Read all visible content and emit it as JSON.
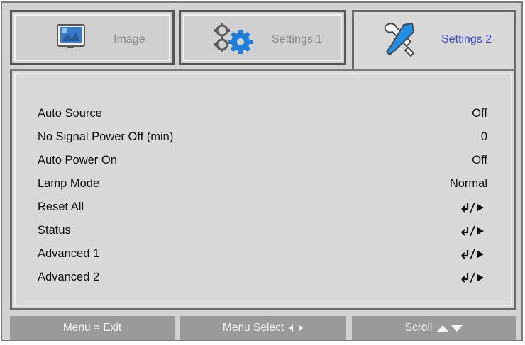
{
  "tabs": [
    {
      "label": "Image",
      "icon": "image-icon",
      "active": false
    },
    {
      "label": "Settings 1",
      "icon": "gears-icon",
      "active": false
    },
    {
      "label": "Settings 2",
      "icon": "tools-icon",
      "active": true
    }
  ],
  "settings": [
    {
      "label": "Auto Source",
      "value": "Off"
    },
    {
      "label": "No Signal Power Off (min)",
      "value": "0"
    },
    {
      "label": "Auto Power On",
      "value": "Off"
    },
    {
      "label": "Lamp Mode",
      "value": "Normal"
    },
    {
      "label": "Reset All",
      "value": "",
      "icon": "enter-arrow-icon"
    },
    {
      "label": "Status",
      "value": "",
      "icon": "enter-arrow-icon"
    },
    {
      "label": "Advanced 1",
      "value": "",
      "icon": "enter-arrow-icon"
    },
    {
      "label": "Advanced 2",
      "value": "",
      "icon": "enter-arrow-icon"
    }
  ],
  "footer": {
    "menu_exit": "Menu = Exit",
    "menu_select": "Menu Select",
    "scroll": "Scroll"
  },
  "colors": {
    "active_tab_text": "#3a4cd0",
    "inactive_tab_text": "#8a8a8a",
    "panel_bg": "#d8d8d8",
    "footer_bg": "#9a9a9a"
  }
}
